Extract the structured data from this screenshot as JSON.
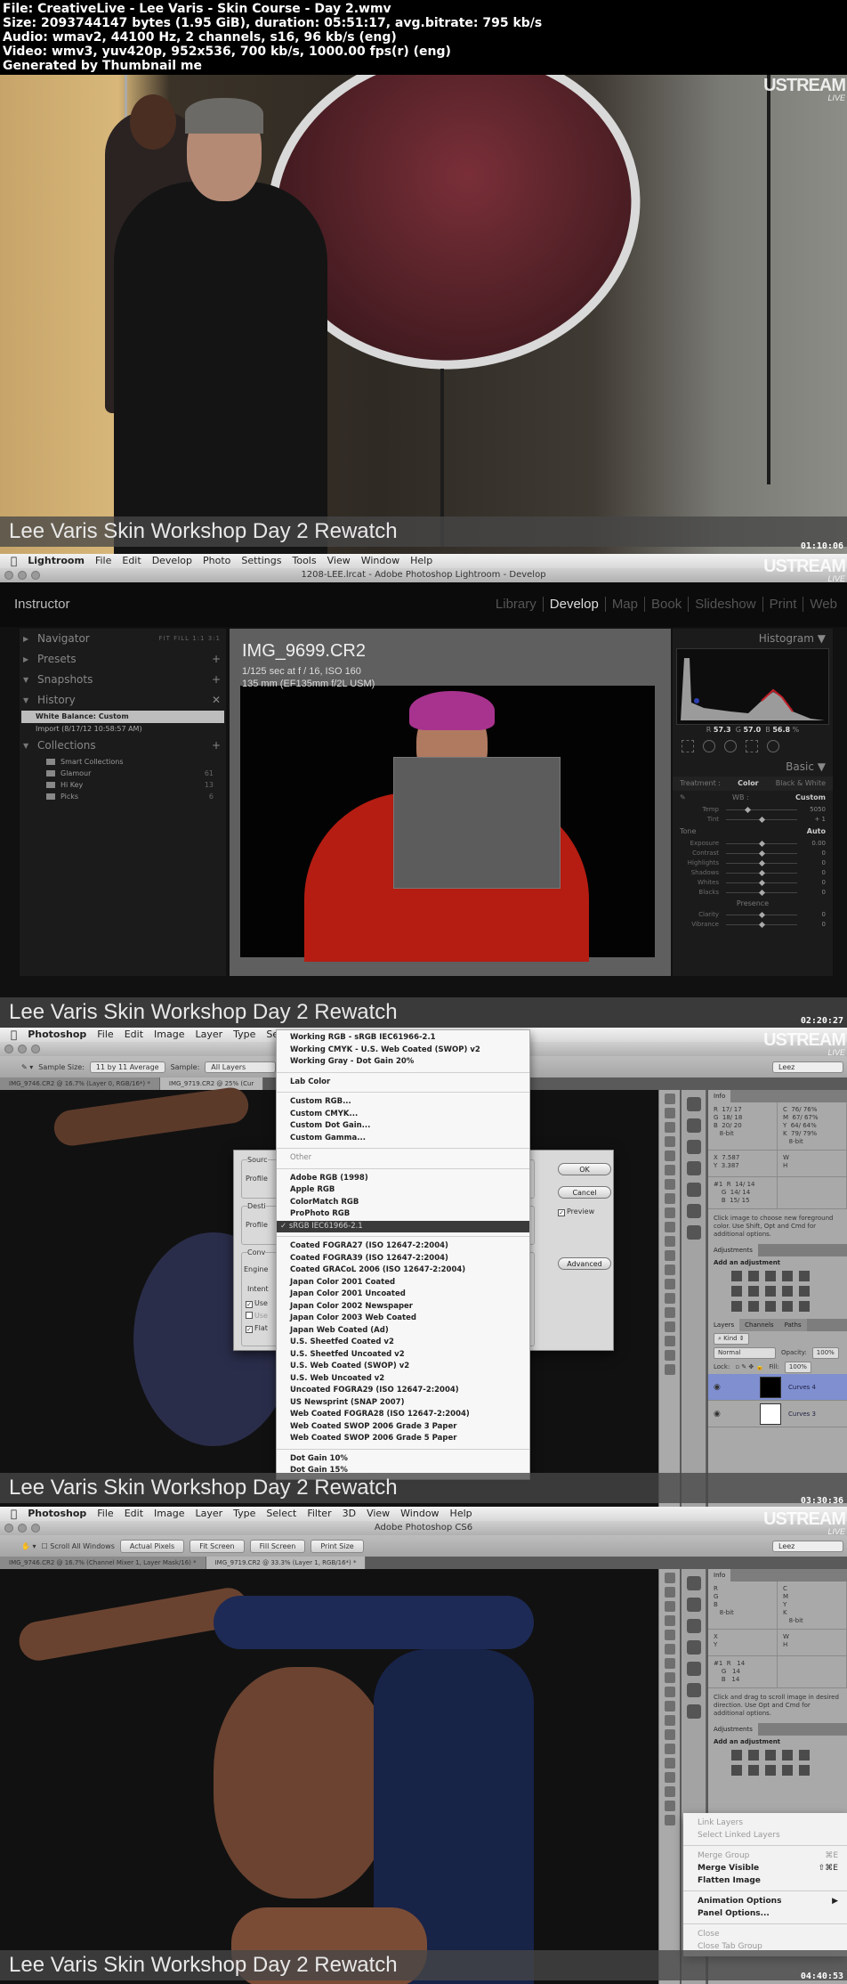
{
  "header": {
    "lines": [
      "File: CreativeLive - Lee Varis - Skin Course - Day 2.wmv",
      "Size: 2093744147 bytes (1.95 GiB), duration: 05:51:17, avg.bitrate: 795 kb/s",
      "Audio: wmav2, 44100 Hz, 2 channels, s16, 96 kb/s (eng)",
      "Video: wmv3, yuv420p, 952x536, 700 kb/s, 1000.00 fps(r) (eng)",
      "Generated by Thumbnail me"
    ]
  },
  "overlay": {
    "caption": "Lee Varis Skin Workshop Day 2 Rewatch",
    "ustream": "USTREAM",
    "live": "LIVE"
  },
  "frames": [
    {
      "timestamp": "01:10:06"
    },
    {
      "timestamp": "02:20:27"
    },
    {
      "timestamp": "03:30:36"
    },
    {
      "timestamp": "04:40:53"
    }
  ],
  "lightroom": {
    "menu": [
      "Lightroom",
      "File",
      "Edit",
      "Develop",
      "Photo",
      "Settings",
      "Tools",
      "View",
      "Window",
      "Help"
    ],
    "window_title": "1208-LEE.lrcat - Adobe Photoshop Lightroom - Develop",
    "identity_plate": "Instructor",
    "modules": [
      "Library",
      "Develop",
      "Map",
      "Book",
      "Slideshow",
      "Print",
      "Web"
    ],
    "active_module": "Develop",
    "left_panel": {
      "navigator": "Navigator",
      "navigator_zoom": "FIT  FILL  1:1  3:1",
      "presets": "Presets",
      "snapshots": "Snapshots",
      "history": "History",
      "history_items": [
        "White Balance: Custom",
        "Import (8/17/12 10:58:57 AM)"
      ],
      "collections": "Collections",
      "collection_items": [
        {
          "name": "Smart Collections",
          "count": ""
        },
        {
          "name": "Glamour",
          "count": "61"
        },
        {
          "name": "Hi Key",
          "count": "13"
        },
        {
          "name": "Picks",
          "count": "6"
        }
      ]
    },
    "image": {
      "filename": "IMG_9699.CR2",
      "exposure": "1/125 sec at f / 16, ISO 160",
      "lens": "135 mm (EF135mm f/2L USM)"
    },
    "right_panel": {
      "histogram": "Histogram",
      "rgb": {
        "r": "57.3",
        "g": "57.0",
        "b": "56.8"
      },
      "basic": "Basic",
      "treatment_label": "Treatment :",
      "treatment_color": "Color",
      "treatment_bw": "Black & White",
      "wb_label": "WB :",
      "wb_value": "Custom",
      "tone": "Tone",
      "auto": "Auto",
      "presence": "Presence",
      "sliders": [
        {
          "label": "Temp",
          "value": "5050",
          "pos": 0.3
        },
        {
          "label": "Tint",
          "value": "+ 1",
          "pos": 0.5
        },
        {
          "label": "Exposure",
          "value": "0.00",
          "pos": 0.5
        },
        {
          "label": "Contrast",
          "value": "0",
          "pos": 0.5
        },
        {
          "label": "Highlights",
          "value": "0",
          "pos": 0.5
        },
        {
          "label": "Shadows",
          "value": "0",
          "pos": 0.5
        },
        {
          "label": "Whites",
          "value": "0",
          "pos": 0.5
        },
        {
          "label": "Blacks",
          "value": "0",
          "pos": 0.5
        },
        {
          "label": "Clarity",
          "value": "0",
          "pos": 0.5
        },
        {
          "label": "Vibrance",
          "value": "0",
          "pos": 0.5
        }
      ]
    }
  },
  "photoshop_convert": {
    "menu": [
      "Photoshop",
      "File",
      "Edit",
      "Image",
      "Layer",
      "Type",
      "Se"
    ],
    "options": {
      "sample_size_label": "Sample Size:",
      "sample_size": "11 by 11 Average",
      "sample_label": "Sample:",
      "sample": "All Layers",
      "workspace": "Leez"
    },
    "tabs": [
      "IMG_9746.CR2 @ 16.7% (Layer 0, RGB/16*) *",
      "IMG_9719.CR2 @ 25% (Cur"
    ],
    "dialog": {
      "source": "Sourc",
      "profile1": "Profile",
      "destination": "Desti",
      "profile2": "Profile",
      "conversion": "Conv",
      "engine": "Engine",
      "intent": "Intent",
      "check1": "Use",
      "check2": "Use",
      "check3": "Flat",
      "ok": "OK",
      "cancel": "Cancel",
      "preview": "Preview",
      "advanced": "Advanced"
    },
    "profile_menu": {
      "working": [
        "Working RGB - sRGB IEC61966-2.1",
        "Working CMYK - U.S. Web Coated (SWOP) v2",
        "Working Gray - Dot Gain 20%"
      ],
      "lab": "Lab Color",
      "custom": [
        "Custom RGB...",
        "Custom CMYK...",
        "Custom Dot Gain...",
        "Custom Gamma..."
      ],
      "other": "Other",
      "rgb": [
        "Adobe RGB (1998)",
        "Apple RGB",
        "ColorMatch RGB",
        "ProPhoto RGB"
      ],
      "selected": "✓ sRGB IEC61966-2.1",
      "cmyk": [
        "Coated FOGRA27 (ISO 12647-2:2004)",
        "Coated FOGRA39 (ISO 12647-2:2004)",
        "Coated GRACoL 2006 (ISO 12647-2:2004)",
        "Japan Color 2001 Coated",
        "Japan Color 2001 Uncoated",
        "Japan Color 2002 Newspaper",
        "Japan Color 2003 Web Coated",
        "Japan Web Coated (Ad)",
        "U.S. Sheetfed Coated v2",
        "U.S. Sheetfed Uncoated v2",
        "U.S. Web Coated (SWOP) v2",
        "U.S. Web Uncoated v2",
        "Uncoated FOGRA29 (ISO 12647-2:2004)",
        "US Newsprint (SNAP 2007)",
        "Web Coated FOGRA28 (ISO 12647-2:2004)",
        "Web Coated SWOP 2006 Grade 3 Paper",
        "Web Coated SWOP 2006 Grade 5 Paper"
      ],
      "gray": [
        "Dot Gain 10%",
        "Dot Gain 15%"
      ]
    },
    "info_panel": {
      "tab": "Info",
      "rgb": "R  17/ 17\nG  18/ 18\nB  20/ 20\n   8-bit",
      "cmyk": "C  76/ 76%\nM  67/ 67%\nY  64/ 64%\nK  79/ 79%\n   8-bit",
      "xy": "X  7.587\nY  3.387",
      "wh": "W\nH",
      "sample1": "#1  R  14/ 14\n    G  14/ 14\n    B  15/ 15",
      "hint": "Click image to choose new foreground color.  Use Shift, Opt and Cmd for additional options."
    },
    "adjustments": {
      "tab": "Adjustments",
      "title": "Add an adjustment"
    },
    "layers": {
      "tabs": [
        "Layers",
        "Channels",
        "Paths"
      ],
      "kind": "Kind",
      "blend": "Normal",
      "opacity_label": "Opacity:",
      "opacity": "100%",
      "lock_label": "Lock:",
      "fill_label": "Fill:",
      "fill": "100%",
      "rows": [
        "Curves 4",
        "Curves 3"
      ]
    }
  },
  "photoshop_cs6": {
    "menu": [
      "Photoshop",
      "File",
      "Edit",
      "Image",
      "Layer",
      "Type",
      "Select",
      "Filter",
      "3D",
      "View",
      "Window",
      "Help"
    ],
    "window_title": "Adobe Photoshop CS6",
    "options": {
      "scroll_all": "Scroll All Windows",
      "actual": "Actual Pixels",
      "fit": "Fit Screen",
      "fill": "Fill Screen",
      "print": "Print Size",
      "workspace": "Leez"
    },
    "tabs": [
      "IMG_9746.CR2 @ 16.7% (Channel Mixer 1, Layer Mask/16) *",
      "IMG_9719.CR2 @ 33.3% (Layer 1, RGB/16*) *"
    ],
    "info_panel": {
      "tab": "Info",
      "rgb": "R\nG\nB\n   8-bit",
      "cmyk": "C\nM\nY\nK\n   8-bit",
      "xy": "X\nY",
      "wh": "W\nH",
      "sample1": "#1  R   14\n    G   14\n    B   14",
      "hint": "Click and drag to scroll image in desired direction.  Use Opt and Cmd for additional options."
    },
    "adjustments": {
      "tab": "Adjustments",
      "title": "Add an adjustment"
    },
    "context_menu": [
      {
        "label": "Link Layers",
        "shortcut": "",
        "disabled": true
      },
      {
        "label": "Select Linked Layers",
        "shortcut": "",
        "disabled": true
      },
      {
        "sep": true
      },
      {
        "label": "Merge Group",
        "shortcut": "⌘E",
        "disabled": true
      },
      {
        "label": "Merge Visible",
        "shortcut": "⇧⌘E",
        "disabled": false
      },
      {
        "label": "Flatten Image",
        "shortcut": "",
        "disabled": false
      },
      {
        "sep": true
      },
      {
        "label": "Animation Options",
        "shortcut": "▶",
        "disabled": false
      },
      {
        "label": "Panel Options...",
        "shortcut": "",
        "disabled": false
      },
      {
        "sep": true
      },
      {
        "label": "Close",
        "shortcut": "",
        "disabled": true
      },
      {
        "label": "Close Tab Group",
        "shortcut": "",
        "disabled": true
      }
    ]
  }
}
